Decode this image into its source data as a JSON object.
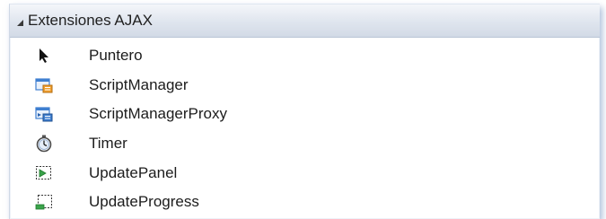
{
  "toolbox": {
    "group_title": "Extensiones AJAX",
    "items": [
      {
        "label": "Puntero",
        "icon": "pointer-icon"
      },
      {
        "label": "ScriptManager",
        "icon": "scriptmanager-icon"
      },
      {
        "label": "ScriptManagerProxy",
        "icon": "scriptmanagerproxy-icon"
      },
      {
        "label": "Timer",
        "icon": "timer-icon"
      },
      {
        "label": "UpdatePanel",
        "icon": "updatepanel-icon"
      },
      {
        "label": "UpdateProgress",
        "icon": "updateprogress-icon"
      }
    ]
  },
  "colors": {
    "header_gradient_top": "#f4f6fa",
    "header_gradient_bottom": "#d2dae6",
    "icon_blue": "#3f7fd0",
    "icon_orange": "#f0a030",
    "icon_green": "#3aa34a"
  }
}
